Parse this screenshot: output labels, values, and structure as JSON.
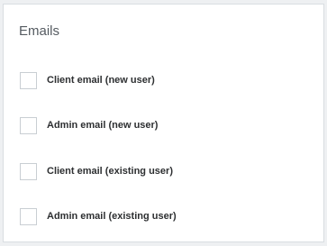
{
  "panel": {
    "title": "Emails"
  },
  "options": [
    {
      "label": "Client email (new user)",
      "checked": false
    },
    {
      "label": "Admin email (new user)",
      "checked": false
    },
    {
      "label": "Client email (existing user)",
      "checked": false
    },
    {
      "label": "Admin email (existing user)",
      "checked": false
    }
  ]
}
